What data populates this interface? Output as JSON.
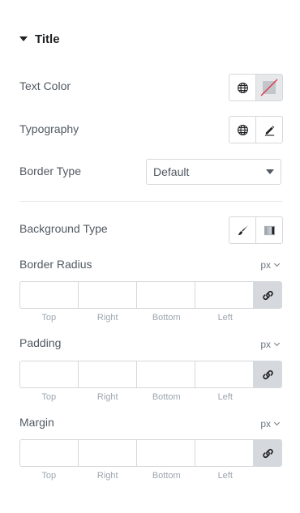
{
  "section": {
    "title": "Title"
  },
  "text_color": {
    "label": "Text Color"
  },
  "typography": {
    "label": "Typography"
  },
  "border_type": {
    "label": "Border Type",
    "value": "Default"
  },
  "background_type": {
    "label": "Background Type"
  },
  "border_radius": {
    "label": "Border Radius",
    "unit": "px",
    "labels": [
      "Top",
      "Right",
      "Bottom",
      "Left"
    ]
  },
  "padding": {
    "label": "Padding",
    "unit": "px",
    "labels": [
      "Top",
      "Right",
      "Bottom",
      "Left"
    ]
  },
  "margin": {
    "label": "Margin",
    "unit": "px",
    "labels": [
      "Top",
      "Right",
      "Bottom",
      "Left"
    ]
  },
  "icons": {
    "global": "globe-icon",
    "color_swatch": "color-swatch-icon",
    "edit": "pencil-icon",
    "classic_bg": "brush-icon",
    "gradient_bg": "gradient-icon",
    "link": "link-icon"
  },
  "colors": {
    "heading": "#1f2124",
    "label": "#515962",
    "border": "#d5d8dc",
    "swatch_slash": "#e0304a"
  }
}
